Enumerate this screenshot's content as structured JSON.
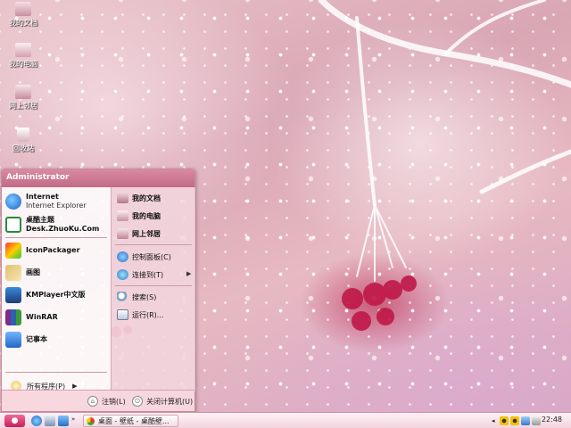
{
  "desktop": {
    "icons": [
      {
        "label": "我的文档",
        "icon": "my-documents-icon"
      },
      {
        "label": "我的电脑",
        "icon": "my-computer-icon"
      },
      {
        "label": "网上邻居",
        "icon": "network-places-icon"
      },
      {
        "label": "回收站",
        "icon": "recycle-bin-icon"
      }
    ]
  },
  "start_menu": {
    "user": "Administrator",
    "pinned": [
      {
        "title": "Internet",
        "subtitle": "Internet Explorer",
        "icon": "internet-explorer-icon"
      },
      {
        "title": "桌酷主题",
        "subtitle": "Desk.ZhuoKu.Com",
        "icon": "zhuoku-theme-icon"
      }
    ],
    "programs": [
      {
        "title": "IconPackager",
        "icon": "iconpackager-icon"
      },
      {
        "title": "画图",
        "icon": "paint-icon"
      },
      {
        "title": "KMPlayer中文版",
        "icon": "kmplayer-icon"
      },
      {
        "title": "WinRAR",
        "icon": "winrar-icon"
      },
      {
        "title": "记事本",
        "icon": "notepad-icon"
      }
    ],
    "all_programs": "所有程序(P)",
    "right_places": [
      {
        "label": "我的文档",
        "icon": "my-documents-icon"
      },
      {
        "label": "我的电脑",
        "icon": "my-computer-icon"
      },
      {
        "label": "网上邻居",
        "icon": "network-places-icon"
      }
    ],
    "right_system": [
      {
        "label": "控制面板(C)",
        "icon": "control-panel-icon"
      },
      {
        "label": "连接到(T)",
        "icon": "connect-to-icon"
      }
    ],
    "right_tools": [
      {
        "label": "搜索(S)",
        "icon": "search-icon"
      },
      {
        "label": "运行(R)...",
        "icon": "run-icon"
      }
    ],
    "logoff": "注销(L)",
    "shutdown": "关闭计算机(U)"
  },
  "taskbar": {
    "task": "桌面 - 壁纸 - 桌酷壁...",
    "clock": "22:48"
  },
  "colors": {
    "accent": "#c8205b",
    "menu_header": "#c26b86"
  }
}
